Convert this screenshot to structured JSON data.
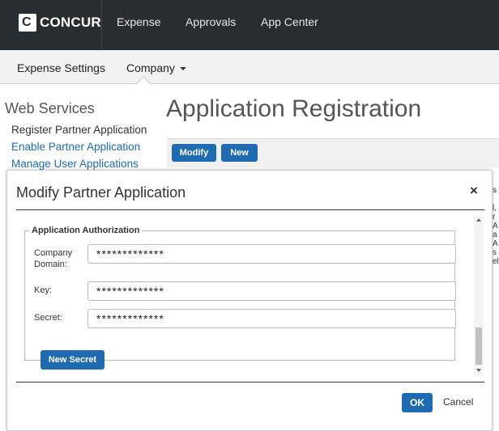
{
  "topnav": {
    "logo_letter": "C",
    "logo_text": "CONCUR",
    "items": [
      "Expense",
      "Approvals",
      "App Center"
    ]
  },
  "subnav": {
    "items": [
      "Expense Settings",
      "Company"
    ]
  },
  "sidebar": {
    "title": "Web Services",
    "items": [
      {
        "label": "Register Partner Application",
        "color": "#333333"
      },
      {
        "label": "Enable Partner Application",
        "color": "#1f6bb2"
      },
      {
        "label": "Manage User Applications",
        "color": "#1f6bb2"
      }
    ]
  },
  "page": {
    "title": "Application Registration",
    "toolbar": {
      "modify_label": "Modify",
      "new_label": "New"
    },
    "bg_right_chars": [
      "s",
      "",
      "l,",
      "r",
      "A",
      "a",
      "A",
      "s",
      "el"
    ]
  },
  "modal": {
    "title": "Modify Partner Application",
    "close_glyph": "×",
    "fieldset_legend": "Application Authorization",
    "fields": [
      {
        "label": "Company Domain:",
        "value": "*************"
      },
      {
        "label": "Key:",
        "value": "*************"
      },
      {
        "label": "Secret:",
        "value": "*************"
      }
    ],
    "new_secret_label": "New Secret",
    "ok_label": "OK",
    "cancel_label": "Cancel"
  },
  "colors": {
    "brand_blue": "#1f6bb2",
    "navbar": "#282d32"
  }
}
